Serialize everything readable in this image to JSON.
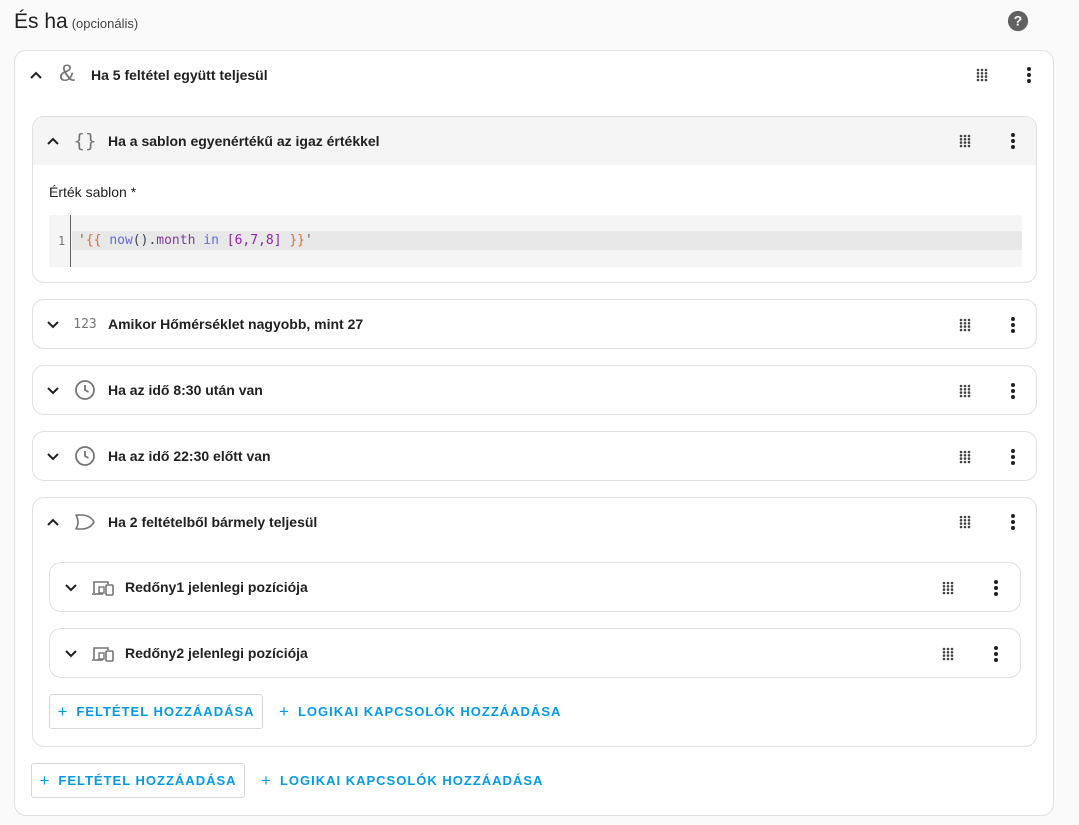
{
  "header": {
    "title": "És ha",
    "subtitle": "(opcionális)"
  },
  "outer_condition": {
    "label": "Ha 5 feltétel együtt teljesül"
  },
  "template_condition": {
    "label": "Ha a sablon egyenértékű az igaz értékkel",
    "field_label": "Érték sablon *",
    "line_number": "1",
    "code": {
      "q1": "'",
      "open": "{{",
      "fn": "now",
      "paren": "()",
      "dot": ".",
      "attr": "month",
      "kw": "in",
      "lb": "[",
      "n1": "6",
      "c1": ",",
      "n2": "7",
      "c2": ",",
      "n3": "8",
      "rb": "]",
      "close": "}}",
      "q2": "'"
    }
  },
  "numeric_condition": {
    "label": "Amikor Hőmérséklet nagyobb, mint 27"
  },
  "time_after_condition": {
    "label": "Ha az idő 8:30 után van"
  },
  "time_before_condition": {
    "label": "Ha az idő 22:30 előtt van"
  },
  "or_condition": {
    "label": "Ha 2 feltételből bármely teljesül",
    "children": [
      {
        "label": "Redőny1 jelenlegi pozíciója"
      },
      {
        "label": "Redőny2 jelenlegi pozíciója"
      }
    ],
    "add_condition_label": "FELTÉTEL HOZZÁADÁSA",
    "add_logic_label": "LOGIKAI KAPCSOLÓK HOZZÁADÁSA"
  },
  "outer_actions": {
    "add_condition_label": "FELTÉTEL HOZZÁADÁSA",
    "add_logic_label": "LOGIKAI KAPCSOLÓK HOZZÁADÁSA"
  },
  "icons": {
    "help": "help-circle-icon",
    "expand": "chevron-up-icon",
    "collapse": "chevron-down-icon",
    "and": "ampersand-icon",
    "template": "code-braces-icon",
    "numeric": "numeric-icon",
    "time": "clock-icon",
    "or": "gate-or-icon",
    "device": "devices-icon",
    "drag": "drag-handle-icon",
    "menu": "dots-vertical-icon",
    "add": "plus-icon"
  },
  "colors": {
    "accent": "#039be5",
    "text": "#212121",
    "icon": "#757575",
    "border": "#e0e0e0"
  }
}
